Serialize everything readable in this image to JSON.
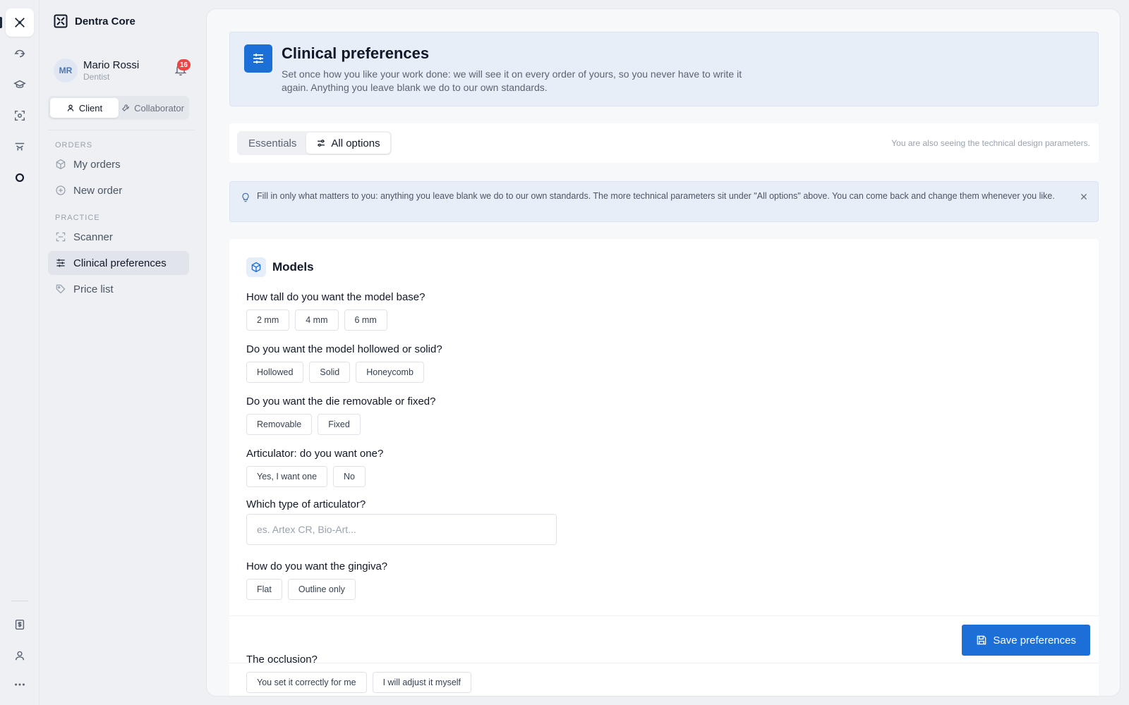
{
  "app": {
    "name": "Dentra Core"
  },
  "user": {
    "initials": "MR",
    "name": "Mario Rossi",
    "role": "Dentist",
    "notifications": "16"
  },
  "role_toggle": {
    "client": "Client",
    "collaborator": "Collaborator"
  },
  "sidebar": {
    "orders_label": "ORDERS",
    "practice_label": "PRACTICE",
    "items": [
      {
        "label": "My orders",
        "icon": "box-icon"
      },
      {
        "label": "New order",
        "icon": "plus-circle-icon"
      },
      {
        "label": "Scanner",
        "icon": "scan-icon"
      },
      {
        "label": "Clinical preferences",
        "icon": "sliders-icon",
        "active": true
      },
      {
        "label": "Price list",
        "icon": "tag-icon"
      }
    ]
  },
  "header": {
    "title": "Clinical preferences",
    "subtitle": "Set once how you like your work done: we will see it on every order of yours, so you never have to write it again. Anything you leave blank we do to our own standards."
  },
  "tabs": {
    "essentials": "Essentials",
    "all_options": "All options",
    "note": "You are also seeing the technical design parameters."
  },
  "tip": "Fill in only what matters to you: anything you leave blank we do to our own standards. The more technical parameters sit under \"All options\" above. You can come back and change them whenever you like.",
  "models": {
    "title": "Models",
    "q1": {
      "label": "How tall do you want the model base?",
      "options": [
        "2 mm",
        "4 mm",
        "6 mm"
      ]
    },
    "q2": {
      "label": "Do you want the model hollowed or solid?",
      "options": [
        "Hollowed",
        "Solid",
        "Honeycomb"
      ]
    },
    "q3": {
      "label": "Do you want the die removable or fixed?",
      "options": [
        "Removable",
        "Fixed"
      ]
    },
    "q4": {
      "label": "Articulator: do you want one?",
      "options": [
        "Yes, I want one",
        "No"
      ]
    },
    "q5": {
      "label": "Which type of articulator?",
      "placeholder": "es. Artex CR, Bio-Art..."
    },
    "q6": {
      "label": "How do you want the gingiva?",
      "options": [
        "Flat",
        "Outline only"
      ]
    },
    "q7": {
      "label": "The occlusion?",
      "options": [
        "You set it correctly for me",
        "I will adjust it myself"
      ]
    }
  },
  "save": {
    "label": "Save preferences"
  },
  "colors": {
    "accent": "#1d6fd8",
    "badge": "#ef4444",
    "info_bg": "#e8eef8"
  }
}
